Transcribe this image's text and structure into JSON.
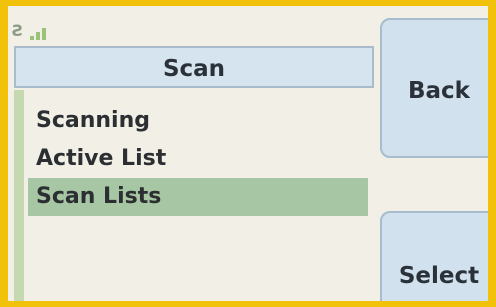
{
  "header": {
    "title": "Scan"
  },
  "menu": {
    "items": [
      {
        "label": "Scanning"
      },
      {
        "label": "Active List"
      },
      {
        "label": "Scan Lists"
      }
    ],
    "selected_index": 2
  },
  "softkeys": {
    "back": "Back",
    "select": "Select"
  },
  "colors": {
    "frame": "#f2c20a",
    "title_bar": "#d5e4ef",
    "selection": "#a7c6a4",
    "softkey": "#d1e1ee"
  }
}
